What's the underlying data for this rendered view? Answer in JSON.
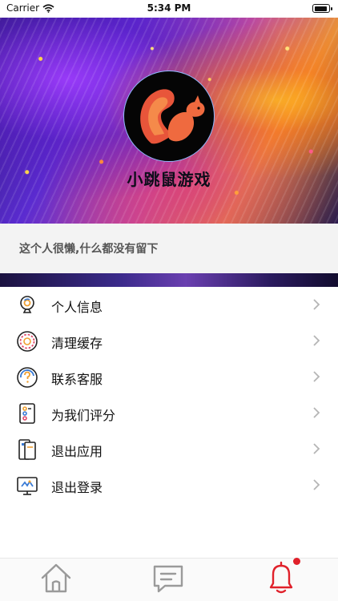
{
  "status_bar": {
    "carrier": "Carrier",
    "time": "5:34 PM"
  },
  "profile": {
    "app_name": "小跳鼠游戏",
    "bio": "这个人很懒,什么都没有留下"
  },
  "menu": {
    "items": [
      {
        "label": "个人信息",
        "icon": "user-info-icon"
      },
      {
        "label": "清理缓存",
        "icon": "clear-cache-icon"
      },
      {
        "label": "联系客服",
        "icon": "customer-service-icon"
      },
      {
        "label": "为我们评分",
        "icon": "rate-app-icon"
      },
      {
        "label": "退出应用",
        "icon": "exit-app-icon"
      },
      {
        "label": "退出登录",
        "icon": "logout-icon"
      }
    ]
  },
  "tab_bar": {
    "tabs": [
      {
        "icon": "home-icon",
        "active": false
      },
      {
        "icon": "message-icon",
        "active": false
      },
      {
        "icon": "bell-icon",
        "active": true,
        "badge": true
      }
    ]
  },
  "colors": {
    "accent": "#e0202a",
    "inactive_icon": "#9a9a9a",
    "avatar_border": "#8fb9ff"
  }
}
